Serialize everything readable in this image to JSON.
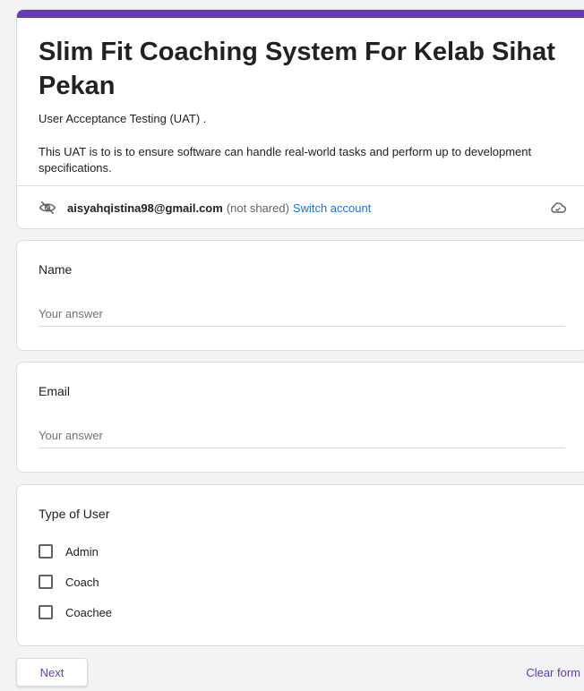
{
  "colors": {
    "accent": "#673ab7",
    "link": "#1a73e8"
  },
  "header": {
    "title": "Slim Fit Coaching System For Kelab Sihat Pekan",
    "subtitle": "User Acceptance Testing (UAT) .",
    "description": "This UAT is to  is to ensure software can handle real-world tasks and perform up to development specifications.",
    "account": {
      "icon": "eye-off-icon",
      "email": "aisyahqistina98@gmail.com",
      "not_shared": "(not shared)",
      "switch_label": "Switch account",
      "save_icon": "cloud-check-icon"
    }
  },
  "questions": {
    "name": {
      "label": "Name",
      "placeholder": "Your answer"
    },
    "email": {
      "label": "Email",
      "placeholder": "Your answer"
    },
    "user_type": {
      "label": "Type of User",
      "options": [
        {
          "label": "Admin",
          "checked": false
        },
        {
          "label": "Coach",
          "checked": false
        },
        {
          "label": "Coachee",
          "checked": false
        }
      ]
    }
  },
  "footer": {
    "next_label": "Next",
    "clear_label": "Clear form"
  }
}
